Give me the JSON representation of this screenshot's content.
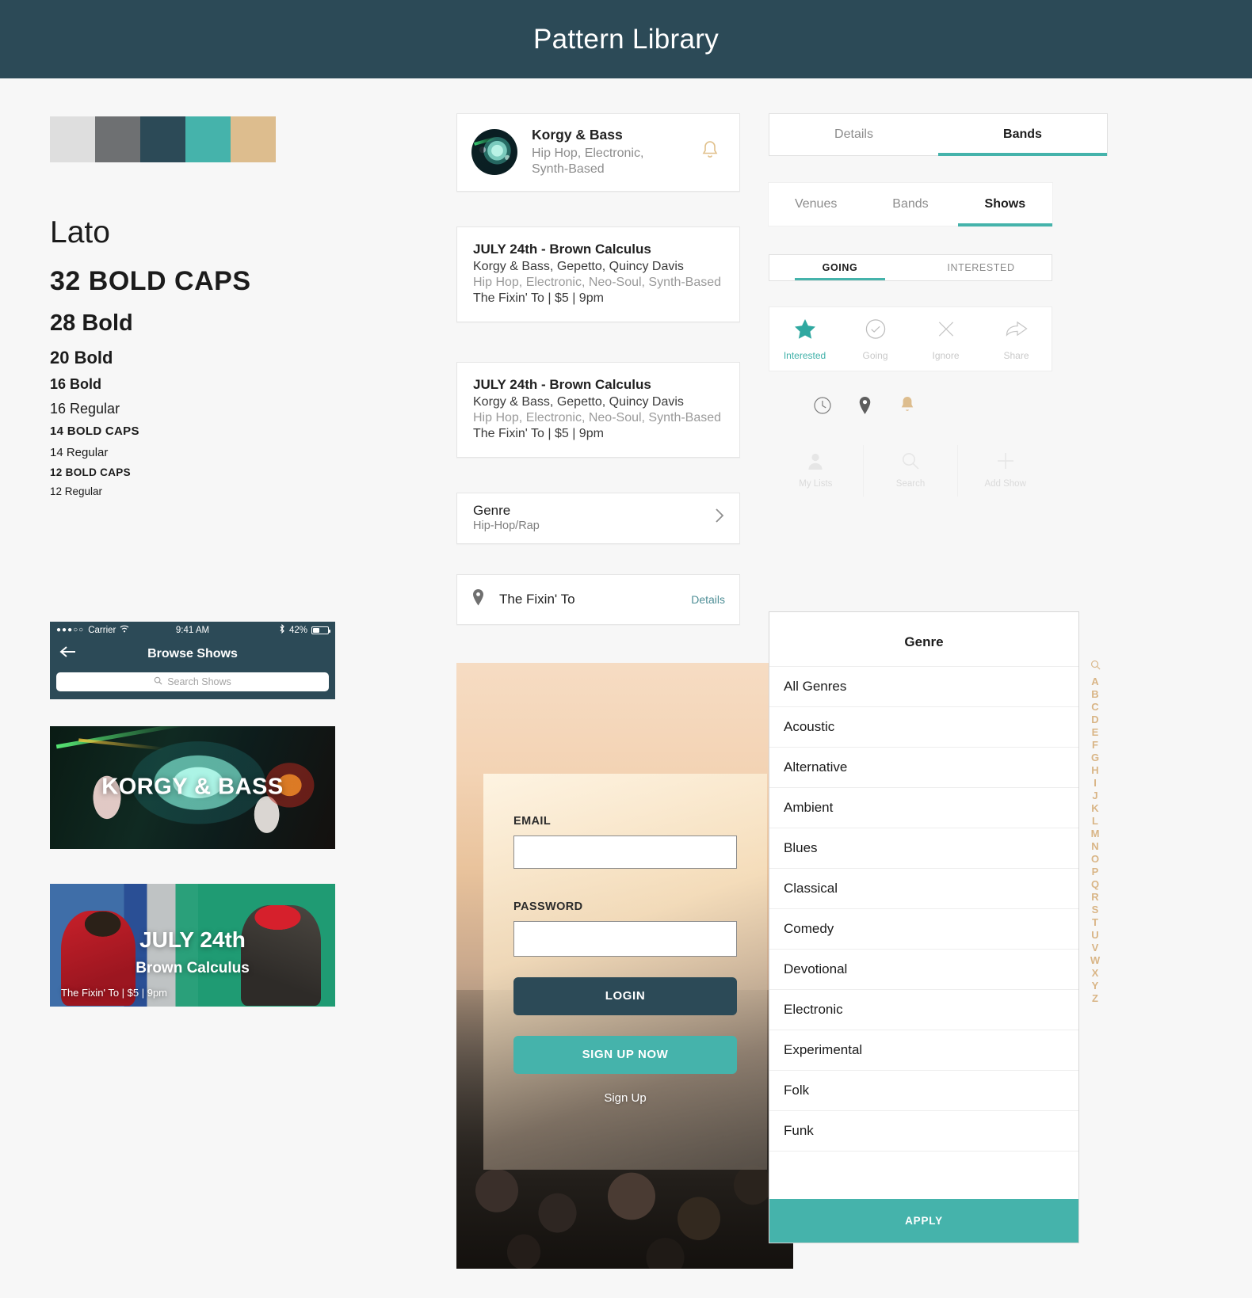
{
  "header": {
    "title": "Pattern Library"
  },
  "palette": {
    "swatches": [
      "#dedede",
      "#6e7072",
      "#2c4a57",
      "#45b3ab",
      "#ddbd8e"
    ],
    "accent_teal": "#45b3ab",
    "dark_slate": "#2c4a57",
    "tan": "#ddbd8e"
  },
  "typography": {
    "family": "Lato",
    "samples": [
      "32 BOLD CAPS",
      "28 Bold",
      "20 Bold",
      "16 Bold",
      "16 Regular",
      "14 BOLD CAPS",
      "14 Regular",
      "12 BOLD CAPS",
      "12 Regular"
    ]
  },
  "band_card": {
    "name": "Korgy & Bass",
    "genres": "Hip Hop, Electronic, Synth-Based",
    "bell_icon": "bell-icon"
  },
  "show_cards": [
    {
      "title": "JULY 24th - Brown Calculus",
      "bands": "Korgy & Bass, Gepetto, Quincy Davis",
      "tags": "Hip Hop, Electronic, Neo-Soul, Synth-Based",
      "venue": "The Fixin' To | $5 | 9pm"
    },
    {
      "title": "JULY 24th - Brown Calculus",
      "bands": "Korgy & Bass, Gepetto, Quincy Davis",
      "tags": "Hip Hop, Electronic, Neo-Soul, Synth-Based",
      "venue": "The Fixin' To | $5 | 9pm"
    }
  ],
  "genre_row": {
    "label": "Genre",
    "value": "Hip-Hop/Rap",
    "chevron_icon": "chevron-right-icon"
  },
  "venue_row": {
    "pin_icon": "map-pin-icon",
    "name": "The Fixin' To",
    "details_link": "Details"
  },
  "tabs_primary": [
    {
      "label": "Details",
      "active": false
    },
    {
      "label": "Bands",
      "active": true
    }
  ],
  "tabs_secondary": [
    {
      "label": "Venues",
      "active": false
    },
    {
      "label": "Bands",
      "active": false
    },
    {
      "label": "Shows",
      "active": true
    }
  ],
  "tabs_tertiary": [
    {
      "label": "GOING",
      "active": true
    },
    {
      "label": "INTERESTED",
      "active": false
    }
  ],
  "action_bar": [
    {
      "label": "Interested",
      "icon": "star-icon",
      "state": "on"
    },
    {
      "label": "Going",
      "icon": "check-circle-icon",
      "state": "off"
    },
    {
      "label": "Ignore",
      "icon": "close-x-icon",
      "state": "off"
    },
    {
      "label": "Share",
      "icon": "share-arrow-icon",
      "state": "off"
    }
  ],
  "status_icons": [
    "clock-icon",
    "map-pin-icon",
    "bell-icon"
  ],
  "tabbar": [
    {
      "label": "My Lists",
      "icon": "person-icon"
    },
    {
      "label": "Search",
      "icon": "search-icon"
    },
    {
      "label": "Add Show",
      "icon": "plus-icon"
    }
  ],
  "phone": {
    "statusbar": {
      "signal_dots": "●●●○○",
      "carrier": "Carrier",
      "wifi_icon": "wifi-icon",
      "time": "9:41 AM",
      "bluetooth_icon": "bluetooth-icon",
      "battery_percent": "42%"
    },
    "navbar": {
      "back_icon": "back-arrow-icon",
      "title": "Browse Shows"
    },
    "search": {
      "icon": "search-icon",
      "placeholder": "Search Shows"
    }
  },
  "banner_band": {
    "caption": "KORGY & BASS"
  },
  "banner_show": {
    "date": "JULY 24th",
    "name": "Brown Calculus",
    "footer": "The Fixin' To | $5 | 9pm"
  },
  "login": {
    "email_label": "EMAIL",
    "email_value": "",
    "password_label": "PASSWORD",
    "password_value": "",
    "login_button": "LOGIN",
    "signup_button": "SIGN UP NOW",
    "signup_link": "Sign Up"
  },
  "genre_panel": {
    "title": "Genre",
    "items": [
      "All Genres",
      "Acoustic",
      "Alternative",
      "Ambient",
      "Blues",
      "Classical",
      "Comedy",
      "Devotional",
      "Electronic",
      "Experimental",
      "Folk",
      "Funk"
    ],
    "apply_button": "APPLY",
    "index_search_icon": "search-icon",
    "index_letters": [
      "A",
      "B",
      "C",
      "D",
      "E",
      "F",
      "G",
      "H",
      "I",
      "J",
      "K",
      "L",
      "M",
      "N",
      "O",
      "P",
      "Q",
      "R",
      "S",
      "T",
      "U",
      "V",
      "W",
      "X",
      "Y",
      "Z"
    ]
  }
}
